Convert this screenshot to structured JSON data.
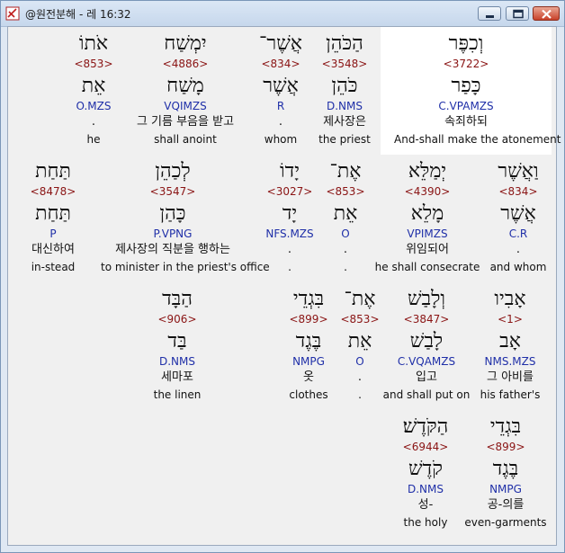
{
  "window": {
    "title": "@원전분해 - 레 16:32"
  },
  "rows": [
    [
      {
        "heb": "וְכִפֶּר",
        "strongs": "<3722>",
        "root": "כָּפַר",
        "morph": "C.VPAMZS",
        "kor": "속죄하되",
        "eng": "And-shall make the atonement"
      },
      {
        "heb": "הַכֹּהֵן",
        "strongs": "<3548>",
        "root": "כֹּהֵן",
        "morph": "D.NMS",
        "kor": "제사장은",
        "eng": "the priest"
      },
      {
        "heb": "אֲשֶׁר־",
        "strongs": "<834>",
        "root": "אֲשֶׁר",
        "morph": "R",
        "kor": ".",
        "eng": "whom"
      },
      {
        "heb": "יִמְשַׁח",
        "strongs": "<4886>",
        "root": "מָשַׁח",
        "morph": "VQIMZS",
        "kor": "그 기름 부음을 받고",
        "eng": "shall anoint"
      },
      {
        "heb": "אֹתוֹ",
        "strongs": "<853>",
        "root": "אֵת",
        "morph": "O.MZS",
        "kor": ".",
        "eng": "he"
      }
    ],
    [
      {
        "heb": "וַאֲשֶׁר",
        "strongs": "<834>",
        "root": "אֲשֶׁר",
        "morph": "C.R",
        "kor": ".",
        "eng": "and whom"
      },
      {
        "heb": "יְמַלֵּא",
        "strongs": "<4390>",
        "root": "מָלֵא",
        "morph": "VPIMZS",
        "kor": "위임되어",
        "eng": "he shall consecrate"
      },
      {
        "heb": "אֶת־",
        "strongs": "<853>",
        "root": "אֵת",
        "morph": "O",
        "kor": ".",
        "eng": "."
      },
      {
        "heb": "יָדוֹ",
        "strongs": "<3027>",
        "root": "יָד",
        "morph": "NFS.MZS",
        "kor": ".",
        "eng": "."
      },
      {
        "heb": "לְכַהֵן",
        "strongs": "<3547>",
        "root": "כָּהַן",
        "morph": "P.VPNG",
        "kor": "제사장의 직분을 행하는",
        "eng": "to minister in the priest's office"
      },
      {
        "heb": "תַּחַת",
        "strongs": "<8478>",
        "root": "תַּחַת",
        "morph": "P",
        "kor": "대신하여",
        "eng": "in-stead"
      }
    ],
    [
      {
        "heb": "אָבִיו",
        "strongs": "<1>",
        "root": "אָב",
        "morph": "NMS.MZS",
        "kor": "그 아비를",
        "eng": "his father's"
      },
      {
        "heb": "וְלָבַשׁ",
        "strongs": "<3847>",
        "root": "לָבַשׁ",
        "morph": "C.VQAMZS",
        "kor": "입고",
        "eng": "and shall put on"
      },
      {
        "heb": "אֶת־",
        "strongs": "<853>",
        "root": "אֵת",
        "morph": "O",
        "kor": ".",
        "eng": "."
      },
      {
        "heb": "בִּגְדֵי",
        "strongs": "<899>",
        "root": "בֶּגֶד",
        "morph": "NMPG",
        "kor": "옷",
        "eng": "clothes"
      },
      {
        "heb": "הַבָּד",
        "strongs": "<906>",
        "root": "בַּד",
        "morph": "D.NMS",
        "kor": "세마포",
        "eng": "the linen"
      }
    ],
    [
      {
        "heb": "בִּגְדֵי",
        "strongs": "<899>",
        "root": "בֶּגֶד",
        "morph": "NMPG",
        "kor": "공-의를",
        "eng": "even-garments"
      },
      {
        "heb": "הַקֹּדֶשׁ׃",
        "strongs": "<6944>",
        "root": "קֹדֶשׁ",
        "morph": "D.NMS",
        "kor": "성-",
        "eng": "the holy"
      }
    ]
  ]
}
